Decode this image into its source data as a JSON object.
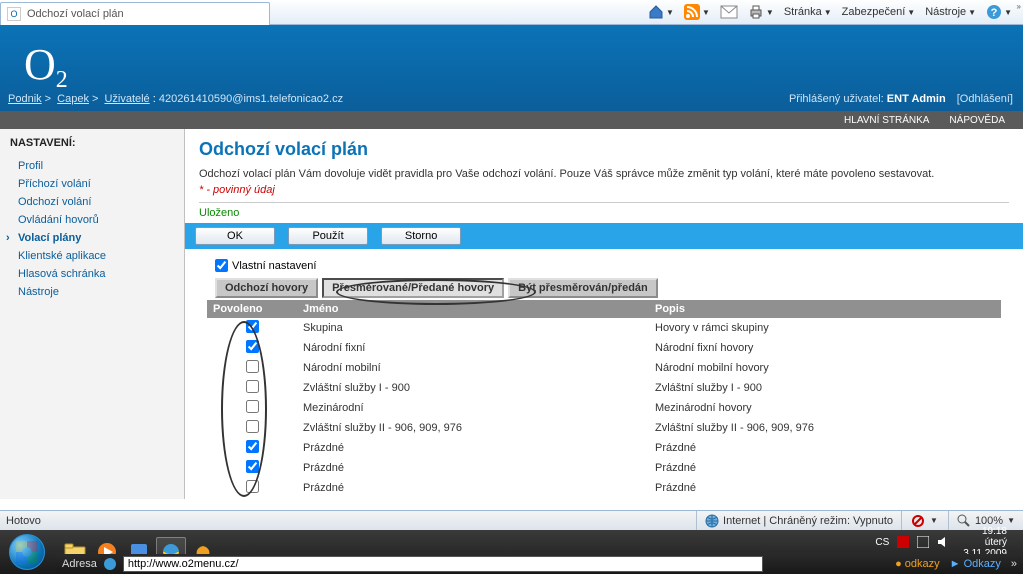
{
  "ie": {
    "tab_title": "Odchozí volací plán",
    "commands": {
      "page": "Stránka",
      "safety": "Zabezpečení",
      "tools": "Nástroje"
    },
    "status_done": "Hotovo",
    "zone": "Internet | Chráněný režim: Vypnuto",
    "zoom": "100%"
  },
  "header": {
    "crumb": {
      "l0": "Podnik",
      "l1": "Capek",
      "l2": "Uživatelé",
      "uid": "420261410590@ims1.telefonicao2.cz"
    },
    "login_prefix": "Přihlášený uživatel:",
    "login_user": "ENT Admin",
    "logout": "[Odhlášení]",
    "sub": {
      "home": "HLAVNÍ STRÁNKA",
      "help": "NÁPOVĚDA"
    }
  },
  "sidebar": {
    "heading": "NASTAVENÍ:",
    "items": [
      "Profil",
      "Příchozí volání",
      "Odchozí volání",
      "Ovládání hovorů",
      "Volací plány",
      "Klientské aplikace",
      "Hlasová schránka",
      "Nástroje"
    ],
    "active_index": 4
  },
  "main": {
    "title": "Odchozí volací plán",
    "desc": "Odchozí volací plán Vám dovoluje vidět pravidla pro Vaše odchozí volání. Pouze Váš správce může změnit typ volání, které máte povoleno sestavovat.",
    "required": "* - povinný údaj",
    "saved": "Uloženo",
    "buttons": {
      "ok": "OK",
      "apply": "Použít",
      "cancel": "Storno"
    },
    "own_settings": "Vlastní nastavení",
    "tabs": [
      "Odchozí hovory",
      "Přesměrované/Předané hovory",
      "Být přesměrován/předán"
    ],
    "selected_tab": 1,
    "columns": {
      "allow": "Povoleno",
      "name": "Jméno",
      "desc": "Popis"
    },
    "rows": [
      {
        "checked": true,
        "name": "Skupina",
        "desc": "Hovory v rámci skupiny"
      },
      {
        "checked": true,
        "name": "Národní fixní",
        "desc": "Národní fixní hovory"
      },
      {
        "checked": false,
        "name": "Národní mobilní",
        "desc": "Národní mobilní hovory"
      },
      {
        "checked": false,
        "name": "Zvláštní služby I - 900",
        "desc": "Zvláštní služby I - 900"
      },
      {
        "checked": false,
        "name": "Mezinárodní",
        "desc": "Mezinárodní hovory"
      },
      {
        "checked": false,
        "name": "Zvláštní služby II - 906, 909, 976",
        "desc": "Zvláštní služby II - 906, 909, 976"
      },
      {
        "checked": true,
        "name": "Prázdné",
        "desc": "Prázdné"
      },
      {
        "checked": true,
        "name": "Prázdné",
        "desc": "Prázdné"
      },
      {
        "checked": false,
        "name": "Prázdné",
        "desc": "Prázdné"
      }
    ]
  },
  "taskbar": {
    "lang": "CS",
    "clock": {
      "time": "19:18",
      "day": "úterý",
      "date": "3.11.2009"
    },
    "addr_label": "Adresa",
    "addr_value": "http://www.o2menu.cz/",
    "links": {
      "l1": "odkazy",
      "l2": "Odkazy"
    }
  }
}
